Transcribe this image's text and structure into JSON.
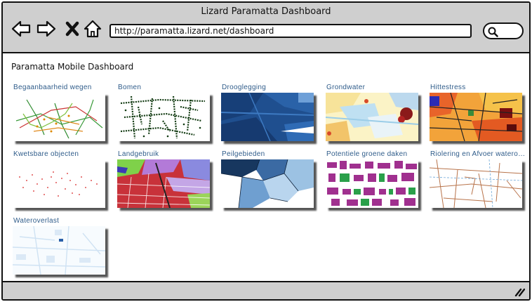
{
  "window": {
    "title": "Lizard Paramatta Dashboard"
  },
  "browser": {
    "url": "http://paramatta.lizard.net/dashboard",
    "icons": [
      "back-arrow-icon",
      "forward-arrow-icon",
      "stop-icon",
      "home-icon",
      "search-icon"
    ]
  },
  "page": {
    "title": "Paramatta Mobile Dashboard"
  },
  "tiles": [
    {
      "label": "Begaanbaarheid wegen"
    },
    {
      "label": "Bomen"
    },
    {
      "label": "Drooglegging"
    },
    {
      "label": "Grondwater"
    },
    {
      "label": "Hittestress"
    },
    {
      "label": "Kwetsbare objecten"
    },
    {
      "label": "Landgebruik"
    },
    {
      "label": "Peilgebieden"
    },
    {
      "label": "Potentiele groene daken"
    },
    {
      "label": "Riolering en Afvoer wateroverlast"
    },
    {
      "label": "Wateroverlast"
    }
  ],
  "colors": {
    "chrome": "#cfcfcf",
    "link": "#2f5c8a",
    "border": "#111111"
  }
}
